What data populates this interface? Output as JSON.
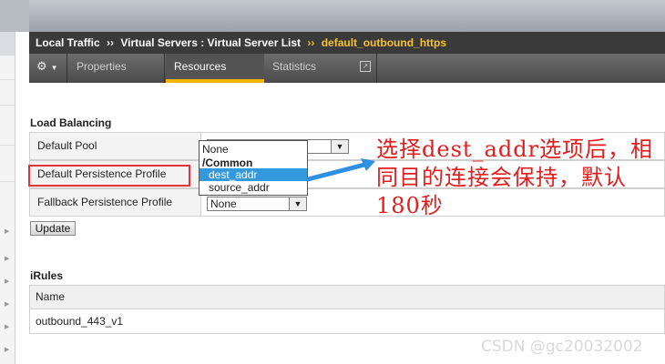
{
  "breadcrumb": {
    "items": [
      "Local Traffic",
      "Virtual Servers : Virtual Server List"
    ],
    "current": "default_outbound_https",
    "separator": "››"
  },
  "tabs": {
    "gear_icon": "gear-icon",
    "properties": "Properties",
    "resources": "Resources",
    "statistics": "Statistics",
    "active": "Resources"
  },
  "load_balancing": {
    "title": "Load Balancing",
    "rows": [
      {
        "label": "Default Pool"
      },
      {
        "label": "Default Persistence Profile"
      },
      {
        "label": "Fallback Persistence Profile",
        "value": "None"
      }
    ],
    "update_label": "Update",
    "dropdown_options": [
      {
        "text": "None",
        "type": "option"
      },
      {
        "text": "/Common",
        "type": "group"
      },
      {
        "text": "dest_addr",
        "type": "option",
        "selected": true
      },
      {
        "text": "source_addr",
        "type": "option"
      }
    ]
  },
  "annotation": {
    "text": "选择dest_addr选项后，相同目的连接会保持，默认180秒",
    "color": "#e11d1d"
  },
  "irules": {
    "title": "iRules",
    "column": "Name",
    "rows": [
      "outbound_443_v1"
    ]
  },
  "watermark": "CSDN @gc20032002",
  "colors": {
    "accent": "#f4b400",
    "selected": "#3399dd",
    "highlight": "#e0343a"
  }
}
